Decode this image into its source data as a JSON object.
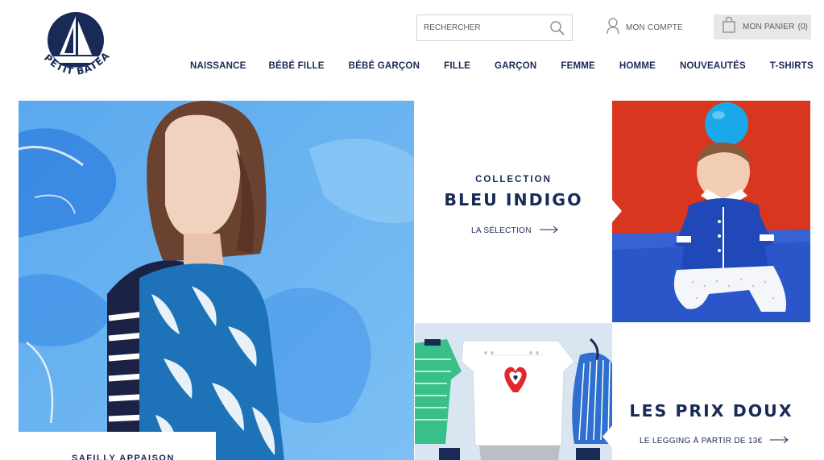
{
  "brand": {
    "logo_text": "PETIT BATEAU",
    "primary_color": "#1a2a57"
  },
  "header": {
    "search_placeholder": "RECHERCHER",
    "account_label": "MON COMPTE",
    "cart_label": "MON PANIER",
    "cart_count": "(0)"
  },
  "nav": [
    {
      "label": "NAISSANCE"
    },
    {
      "label": "BÉBÉ FILLE"
    },
    {
      "label": "BÉBÉ GARÇON"
    },
    {
      "label": "FILLE"
    },
    {
      "label": "GARÇON"
    },
    {
      "label": "FEMME"
    },
    {
      "label": "HOMME"
    },
    {
      "label": "NOUVEAUTÉS"
    },
    {
      "label": "T-SHIRTS"
    }
  ],
  "promos": {
    "indigo": {
      "kicker": "COLLECTION",
      "title": "BLEU INDIGO",
      "link": "LA SÉLECTION"
    },
    "prix": {
      "title": "LES PRIX DOUX",
      "link": "LE LEGGING À PARTIR DE 13€"
    },
    "left_caption": "SAFILLY APPAISON"
  },
  "icons": {
    "search": "search-icon",
    "account": "user-icon",
    "cart": "bag-icon",
    "arrow": "arrow-right-icon"
  }
}
